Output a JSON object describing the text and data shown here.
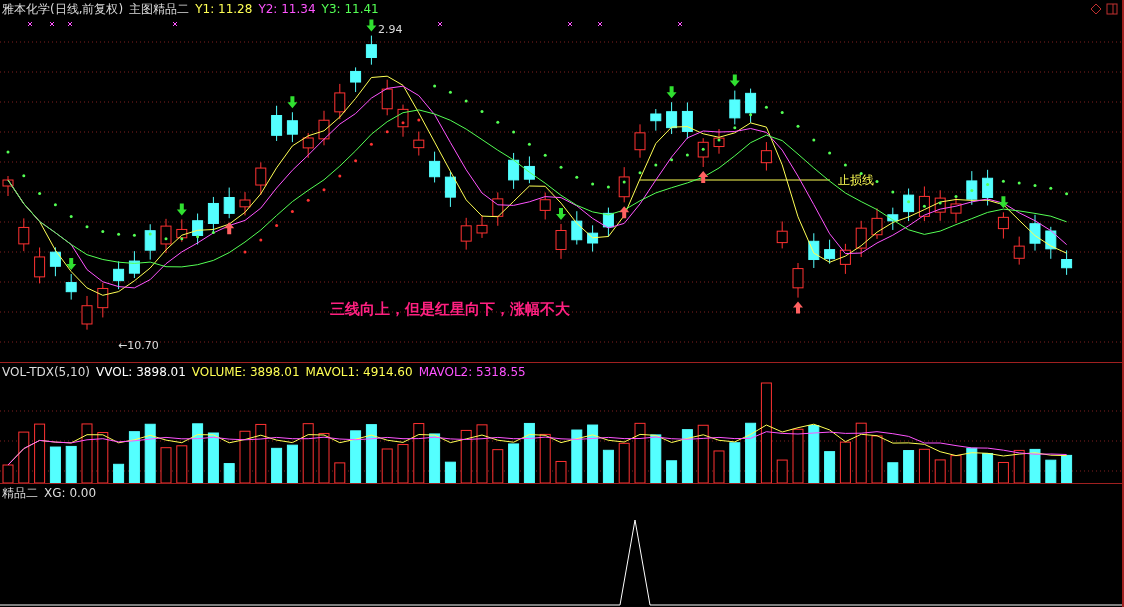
{
  "title": {
    "stock": "雅本化学(日线,前复权)",
    "indicator": "主图精品二"
  },
  "ma_readings": [
    {
      "label": "Y1: 11.28",
      "color": "#ffff54"
    },
    {
      "label": "Y2: 11.34",
      "color": "#ff54ff"
    },
    {
      "label": "Y3: 11.41",
      "color": "#54ff54"
    }
  ],
  "price_labels": {
    "high": "2.94",
    "low": "←10.70"
  },
  "stop_loss_label": "止损线",
  "annotation": "三线向上，但是红星向下，涨幅不大",
  "volume_panel": {
    "name": "VOL-TDX(5,10)",
    "readings": [
      {
        "label": "VVOL: 3898.01",
        "color": "#ffffff"
      },
      {
        "label": "VOLUME: 3898.01",
        "color": "#ffff54"
      },
      {
        "label": "MAVOL1: 4914.60",
        "color": "#ffff54"
      },
      {
        "label": "MAVOL2: 5318.55",
        "color": "#ff54ff"
      }
    ]
  },
  "xg_panel": {
    "name": "精品二",
    "reading": "XG: 0.00"
  }
}
